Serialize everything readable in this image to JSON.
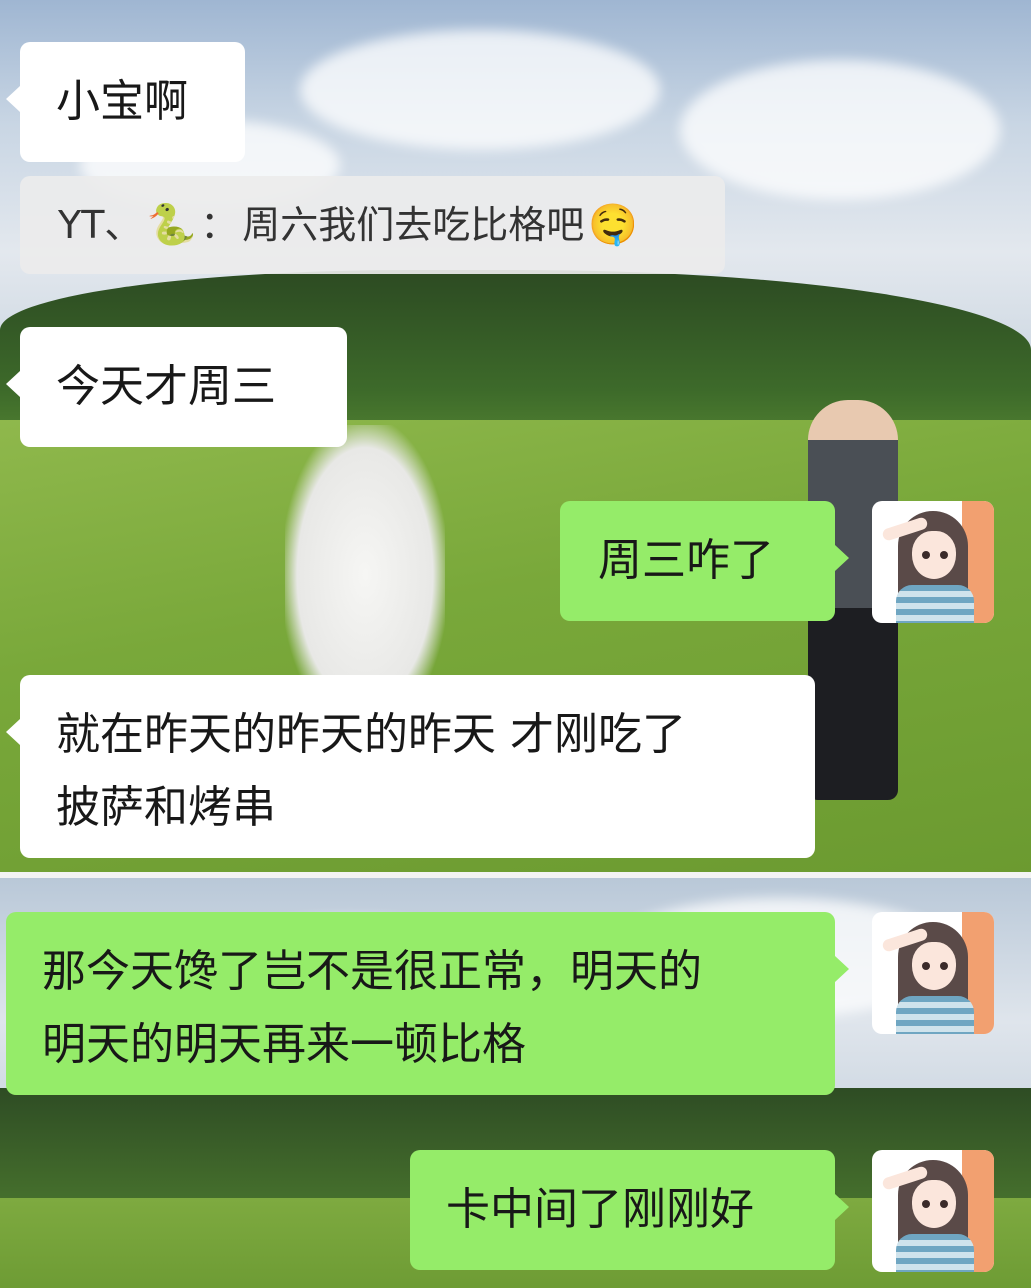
{
  "messages": [
    {
      "side": "left",
      "text": "小宝啊"
    },
    {
      "side": "left",
      "text": "今天才周三"
    },
    {
      "side": "right",
      "text": "周三咋了"
    },
    {
      "side": "left",
      "text": "就在昨天的昨天的昨天 才刚吃了\n披萨和烤串"
    },
    {
      "side": "right",
      "text": "那今天馋了岂不是很正常，明天的\n明天的明天再来一顿比格"
    },
    {
      "side": "right",
      "text": "卡中间了刚刚好"
    }
  ],
  "quote": {
    "sender": "YT、",
    "sender_emoji": "🐍",
    "separator": "：",
    "text": "周六我们去吃比格吧",
    "trailing_emoji": "🤤"
  },
  "icons": {
    "avatar": "user-avatar-icon",
    "snake": "snake-emoji",
    "drool": "drooling-face-emoji"
  },
  "colors": {
    "incoming_bubble": "#ffffff",
    "outgoing_bubble": "#95ec69",
    "quote_background": "#ececec",
    "text": "#181818"
  }
}
